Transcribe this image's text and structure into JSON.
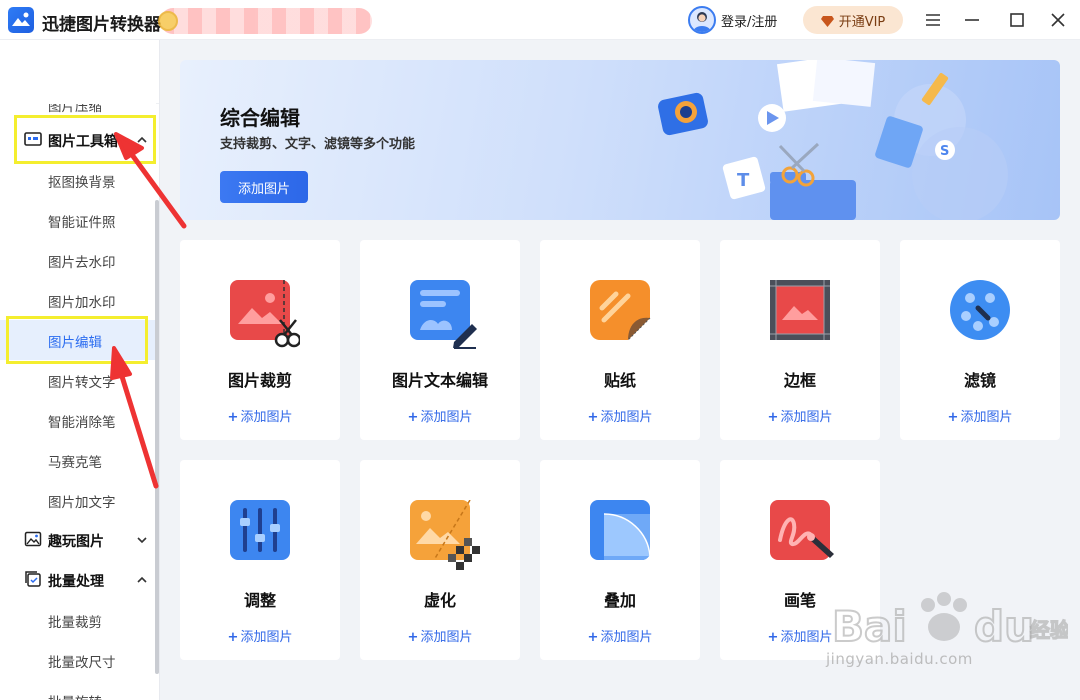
{
  "app": {
    "title": "迅捷图片转换器"
  },
  "header": {
    "login_label": "登录/注册",
    "vip_label": "开通VIP"
  },
  "sidebar": {
    "partial_item": "图片压缩",
    "toolbox_group": "图片工具箱",
    "toolbox_items": [
      "抠图换背景",
      "智能证件照",
      "图片去水印",
      "图片加水印",
      "图片编辑",
      "图片转文字",
      "智能消除笔",
      "马赛克笔",
      "图片加文字"
    ],
    "fun_group": "趣玩图片",
    "batch_group": "批量处理",
    "batch_items": [
      "批量裁剪",
      "批量改尺寸",
      "批量旋转"
    ]
  },
  "banner": {
    "title": "综合编辑",
    "subtitle": "支持裁剪、文字、滤镜等多个功能",
    "button": "添加图片"
  },
  "tools": [
    {
      "title": "图片裁剪",
      "action": "添加图片",
      "icon": "crop-icon"
    },
    {
      "title": "图片文本编辑",
      "action": "添加图片",
      "icon": "text-edit-icon"
    },
    {
      "title": "贴纸",
      "action": "添加图片",
      "icon": "sticker-icon"
    },
    {
      "title": "边框",
      "action": "添加图片",
      "icon": "border-icon"
    },
    {
      "title": "滤镜",
      "action": "添加图片",
      "icon": "filter-icon"
    },
    {
      "title": "调整",
      "action": "添加图片",
      "icon": "adjust-icon"
    },
    {
      "title": "虚化",
      "action": "添加图片",
      "icon": "blur-icon"
    },
    {
      "title": "叠加",
      "action": "添加图片",
      "icon": "overlay-icon"
    },
    {
      "title": "画笔",
      "action": "添加图片",
      "icon": "brush-icon"
    }
  ],
  "watermark": {
    "text": "jingyan.baidu.com"
  },
  "colors": {
    "accent": "#2b6cf0",
    "highlight": "#f4ee2e",
    "arrow": "#ee3333"
  }
}
